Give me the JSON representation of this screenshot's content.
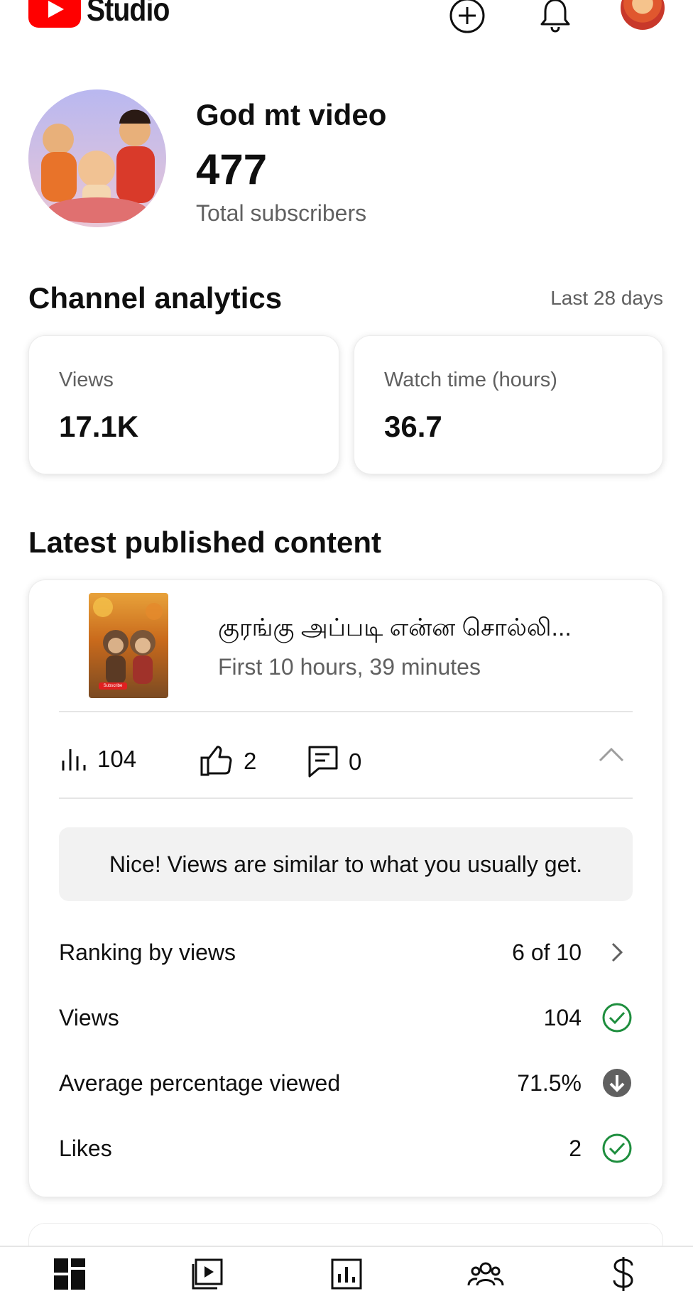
{
  "header": {
    "app_name": "Studio",
    "create_icon": "add-circle-icon",
    "notifications_icon": "bell-icon"
  },
  "channel": {
    "name": "God mt video",
    "subscriber_count": "477",
    "subscriber_label": "Total subscribers"
  },
  "analytics": {
    "title": "Channel analytics",
    "period": "Last 28 days",
    "metrics": [
      {
        "label": "Views",
        "value": "17.1K"
      },
      {
        "label": "Watch time (hours)",
        "value": "36.7"
      }
    ]
  },
  "latest": {
    "title": "Latest published content",
    "video": {
      "title": "குரங்கு அப்படி என்ன சொல்லி...",
      "subtitle": "First 10 hours, 39 minutes",
      "thumb_badge": "Subscribe"
    },
    "stats": {
      "views": "104",
      "likes": "2",
      "comments": "0"
    },
    "notice": "Nice! Views are similar to what you usually get.",
    "rows": [
      {
        "label": "Ranking by views",
        "value": "6 of 10",
        "icon": "chevron-right-icon"
      },
      {
        "label": "Views",
        "value": "104",
        "icon": "check-circle-icon"
      },
      {
        "label": "Average percentage viewed",
        "value": "71.5%",
        "icon": "arrow-down-circle-icon"
      },
      {
        "label": "Likes",
        "value": "2",
        "icon": "check-circle-icon"
      }
    ]
  },
  "colors": {
    "brand_red": "#ff0000",
    "success_green": "#1e8e3e",
    "muted_text": "#606060"
  },
  "bottom_nav": [
    {
      "icon": "dashboard-icon"
    },
    {
      "icon": "content-icon"
    },
    {
      "icon": "analytics-icon"
    },
    {
      "icon": "community-icon"
    },
    {
      "icon": "earn-icon"
    }
  ]
}
